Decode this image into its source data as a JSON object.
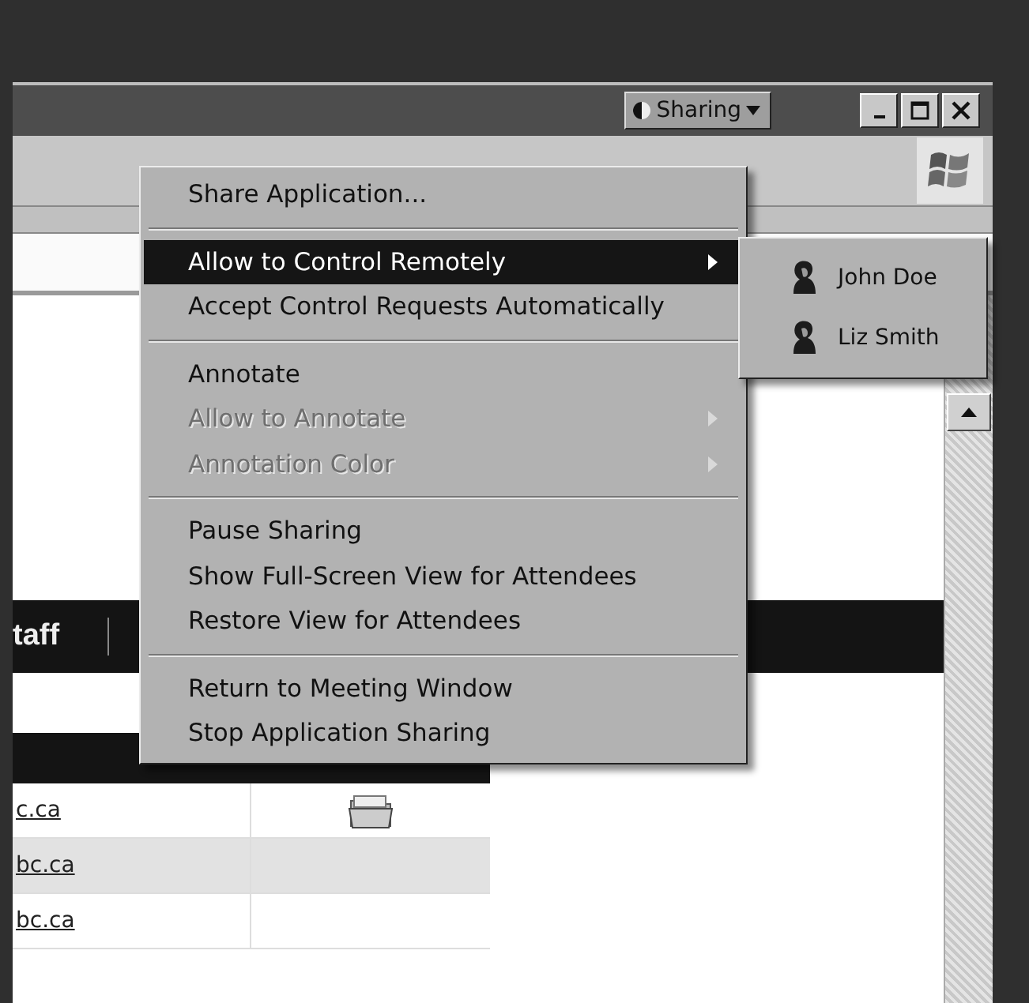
{
  "title_bar": {
    "sharing_button": "Sharing"
  },
  "page": {
    "nav_text": "taff",
    "table_rows": [
      {
        "link": "c.ca",
        "has_folder": true,
        "shaded": false
      },
      {
        "link": "bc.ca",
        "has_folder": false,
        "shaded": true
      },
      {
        "link": "bc.ca",
        "has_folder": false,
        "shaded": false
      }
    ]
  },
  "context_menu": {
    "groups": [
      [
        {
          "label": "Share Application...",
          "disabled": false,
          "submenu": false,
          "highlighted": false
        }
      ],
      [
        {
          "label": "Allow to Control Remotely",
          "disabled": false,
          "submenu": true,
          "highlighted": true
        },
        {
          "label": "Accept Control Requests Automatically",
          "disabled": false,
          "submenu": false,
          "highlighted": false
        }
      ],
      [
        {
          "label": "Annotate",
          "disabled": false,
          "submenu": false,
          "highlighted": false
        },
        {
          "label": "Allow to Annotate",
          "disabled": true,
          "submenu": true,
          "highlighted": false
        },
        {
          "label": "Annotation Color",
          "disabled": true,
          "submenu": true,
          "highlighted": false
        }
      ],
      [
        {
          "label": "Pause Sharing",
          "disabled": false,
          "submenu": false,
          "highlighted": false
        },
        {
          "label": "Show Full-Screen View for Attendees",
          "disabled": false,
          "submenu": false,
          "highlighted": false
        },
        {
          "label": "Restore View for Attendees",
          "disabled": false,
          "submenu": false,
          "highlighted": false
        }
      ],
      [
        {
          "label": "Return to Meeting Window",
          "disabled": false,
          "submenu": false,
          "highlighted": false
        },
        {
          "label": "Stop Application Sharing",
          "disabled": false,
          "submenu": false,
          "highlighted": false
        }
      ]
    ]
  },
  "submenu": {
    "items": [
      {
        "label": "John Doe"
      },
      {
        "label": "Liz Smith"
      }
    ]
  }
}
